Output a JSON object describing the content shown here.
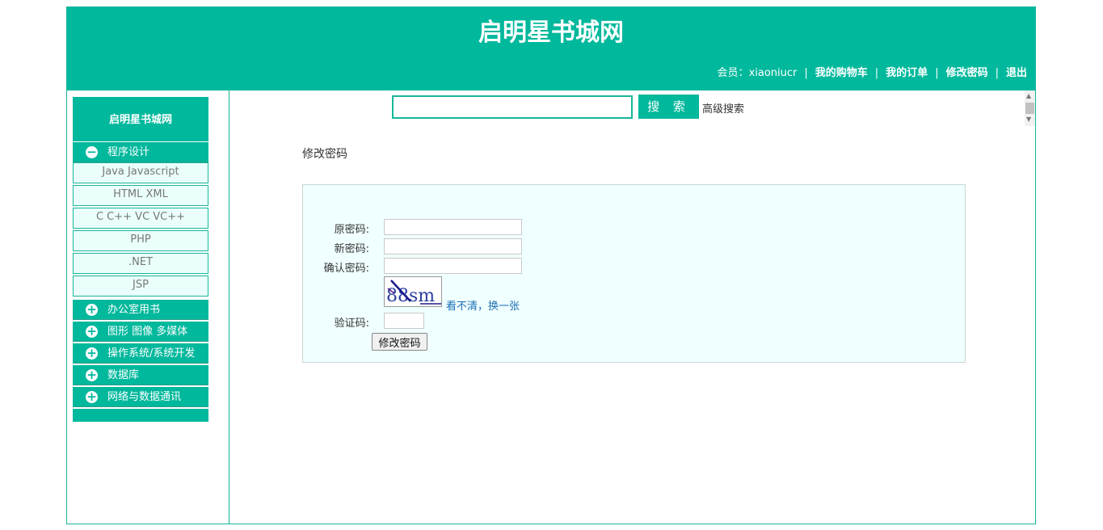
{
  "header": {
    "site_title": "启明星书城网",
    "member_label": "会员：",
    "username": "xiaoniucr",
    "links": [
      "我的购物车",
      "我的订单",
      "修改密码",
      "退出"
    ]
  },
  "sidebar": {
    "title": "启明星书城网",
    "categories": [
      {
        "label": "程序设计",
        "expanded": true,
        "icon": "minus-circle-icon",
        "items": [
          "Java Javascript",
          "HTML XML",
          "C C++ VC VC++",
          "PHP",
          ".NET",
          "JSP"
        ]
      },
      {
        "label": "办公室用书",
        "expanded": false,
        "icon": "plus-circle-icon"
      },
      {
        "label": "图形 图像 多媒体",
        "expanded": false,
        "icon": "plus-circle-icon"
      },
      {
        "label": "操作系统/系统开发",
        "expanded": false,
        "icon": "plus-circle-icon"
      },
      {
        "label": "数据库",
        "expanded": false,
        "icon": "plus-circle-icon"
      },
      {
        "label": "网络与数据通讯",
        "expanded": false,
        "icon": "plus-circle-icon"
      }
    ]
  },
  "search": {
    "value": "",
    "button_label": "搜 索",
    "advanced_label": "高级搜索"
  },
  "form": {
    "heading": "修改密码",
    "old_password_label": "原密码:",
    "new_password_label": "新密码:",
    "confirm_password_label": "确认密码:",
    "captcha_label": "验证码:",
    "captcha_text": "88sm",
    "captcha_refresh": "看不清，换一张",
    "submit_label": "修改密码"
  },
  "colors": {
    "brand": "#00b89c",
    "form_bg": "#f0ffff",
    "submenu_bg": "#eafffb",
    "link": "#1a6fb5"
  }
}
